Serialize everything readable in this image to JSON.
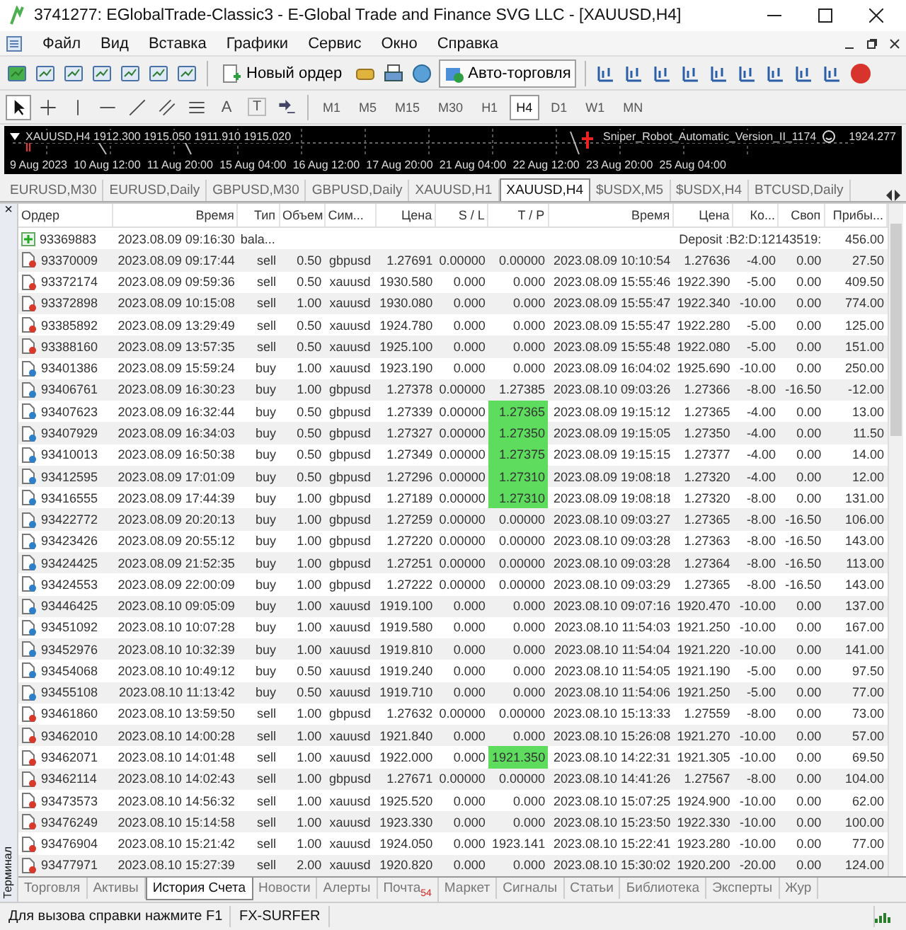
{
  "window": {
    "title": "3741277: EGlobalTrade-Classic3 - E-Global Trade and Finance SVG LLC - [XAUUSD,H4]"
  },
  "menu": [
    "Файл",
    "Вид",
    "Вставка",
    "Графики",
    "Сервис",
    "Окно",
    "Справка"
  ],
  "toolbar": {
    "new_order": "Новый ордер",
    "auto_trading": {
      "label": "Авто-торговля",
      "on": true
    }
  },
  "draw_tools": [
    {
      "kind": "cursor",
      "selected": true
    },
    {
      "kind": "crosshair",
      "selected": false
    },
    {
      "kind": "vline",
      "selected": false
    },
    {
      "kind": "hline",
      "selected": false
    },
    {
      "kind": "trend",
      "selected": false
    },
    {
      "kind": "channel",
      "selected": false
    },
    {
      "kind": "fibo",
      "selected": false
    },
    {
      "kind": "text",
      "label": "A",
      "selected": false
    },
    {
      "kind": "label",
      "label": "T",
      "selected": false
    },
    {
      "kind": "arrows",
      "selected": false
    }
  ],
  "timeframes": [
    {
      "label": "M1",
      "selected": false
    },
    {
      "label": "M5",
      "selected": false
    },
    {
      "label": "M15",
      "selected": false
    },
    {
      "label": "M30",
      "selected": false
    },
    {
      "label": "H1",
      "selected": false
    },
    {
      "label": "H4",
      "selected": true
    },
    {
      "label": "D1",
      "selected": false
    },
    {
      "label": "W1",
      "selected": false
    },
    {
      "label": "MN",
      "selected": false
    }
  ],
  "chart": {
    "symbol_line": "XAUUSD,H4  1912.300 1915.050 1911.910 1915.020",
    "expert": "Sniper_Robot_Automatic_Version_II_1174",
    "price": "1924.277",
    "dates": [
      "9 Aug 2023",
      "10 Aug 12:00",
      "11 Aug 20:00",
      "15 Aug 04:00",
      "16 Aug 12:00",
      "17 Aug 20:00",
      "21 Aug 04:00",
      "22 Aug 12:00",
      "23 Aug 20:00",
      "25 Aug 04:00"
    ]
  },
  "chart_tabs": [
    {
      "label": "EURUSD,M30",
      "selected": false
    },
    {
      "label": "EURUSD,Daily",
      "selected": false
    },
    {
      "label": "GBPUSD,M30",
      "selected": false
    },
    {
      "label": "GBPUSD,Daily",
      "selected": false
    },
    {
      "label": "XAUUSD,H1",
      "selected": false
    },
    {
      "label": "XAUUSD,H4",
      "selected": true
    },
    {
      "label": "$USDX,M5",
      "selected": false
    },
    {
      "label": "$USDX,H4",
      "selected": false
    },
    {
      "label": "BTCUSD,Daily",
      "selected": false
    }
  ],
  "terminal": {
    "label": "Терминал",
    "close": "×"
  },
  "table": {
    "columns": [
      "Ордер",
      "Время",
      "Тип",
      "Объем",
      "Сим...",
      "Цена",
      "S / L",
      "T / P",
      "Время",
      "Цена",
      "Ко...",
      "Своп",
      "Прибы..."
    ],
    "rows": [
      {
        "kind": "balance",
        "order": "93369883",
        "open_time": "2023.08.09 09:16:30",
        "type": "bala...",
        "comment": "Deposit :B2:D:12143519:",
        "profit": "456.00"
      },
      {
        "kind": "sell",
        "order": "93370009",
        "open_time": "2023.08.09 09:17:44",
        "type": "sell",
        "volume": "0.50",
        "symbol": "gbpusd",
        "price": "1.27691",
        "sl": "0.00000",
        "tp": "0.00000",
        "tp_hit": false,
        "close_time": "2023.08.09 10:10:54",
        "close_price": "1.27636",
        "commission": "-4.00",
        "swap": "0.00",
        "profit": "27.50"
      },
      {
        "kind": "sell",
        "order": "93372174",
        "open_time": "2023.08.09 09:59:36",
        "type": "sell",
        "volume": "0.50",
        "symbol": "xauusd",
        "price": "1930.580",
        "sl": "0.000",
        "tp": "0.000",
        "tp_hit": false,
        "close_time": "2023.08.09 15:55:46",
        "close_price": "1922.390",
        "commission": "-5.00",
        "swap": "0.00",
        "profit": "409.50"
      },
      {
        "kind": "sell",
        "order": "93372898",
        "open_time": "2023.08.09 10:15:08",
        "type": "sell",
        "volume": "1.00",
        "symbol": "xauusd",
        "price": "1930.080",
        "sl": "0.000",
        "tp": "0.000",
        "tp_hit": false,
        "close_time": "2023.08.09 15:55:47",
        "close_price": "1922.340",
        "commission": "-10.00",
        "swap": "0.00",
        "profit": "774.00"
      },
      {
        "kind": "sell",
        "order": "93385892",
        "open_time": "2023.08.09 13:29:49",
        "type": "sell",
        "volume": "0.50",
        "symbol": "xauusd",
        "price": "1924.780",
        "sl": "0.000",
        "tp": "0.000",
        "tp_hit": false,
        "close_time": "2023.08.09 15:55:47",
        "close_price": "1922.280",
        "commission": "-5.00",
        "swap": "0.00",
        "profit": "125.00"
      },
      {
        "kind": "sell",
        "order": "93388160",
        "open_time": "2023.08.09 13:57:35",
        "type": "sell",
        "volume": "0.50",
        "symbol": "xauusd",
        "price": "1925.100",
        "sl": "0.000",
        "tp": "0.000",
        "tp_hit": false,
        "close_time": "2023.08.09 15:55:48",
        "close_price": "1922.080",
        "commission": "-5.00",
        "swap": "0.00",
        "profit": "151.00"
      },
      {
        "kind": "buy",
        "order": "93401386",
        "open_time": "2023.08.09 15:59:24",
        "type": "buy",
        "volume": "1.00",
        "symbol": "xauusd",
        "price": "1923.190",
        "sl": "0.000",
        "tp": "0.000",
        "tp_hit": false,
        "close_time": "2023.08.09 16:04:02",
        "close_price": "1925.690",
        "commission": "-10.00",
        "swap": "0.00",
        "profit": "250.00"
      },
      {
        "kind": "buy",
        "order": "93406761",
        "open_time": "2023.08.09 16:30:23",
        "type": "buy",
        "volume": "1.00",
        "symbol": "gbpusd",
        "price": "1.27378",
        "sl": "0.00000",
        "tp": "1.27385",
        "tp_hit": false,
        "close_time": "2023.08.10 09:03:26",
        "close_price": "1.27366",
        "commission": "-8.00",
        "swap": "-16.50",
        "profit": "-12.00"
      },
      {
        "kind": "buy",
        "order": "93407623",
        "open_time": "2023.08.09 16:32:44",
        "type": "buy",
        "volume": "0.50",
        "symbol": "gbpusd",
        "price": "1.27339",
        "sl": "0.00000",
        "tp": "1.27365",
        "tp_hit": true,
        "close_time": "2023.08.09 19:15:12",
        "close_price": "1.27365",
        "commission": "-4.00",
        "swap": "0.00",
        "profit": "13.00"
      },
      {
        "kind": "buy",
        "order": "93407929",
        "open_time": "2023.08.09 16:34:03",
        "type": "buy",
        "volume": "0.50",
        "symbol": "gbpusd",
        "price": "1.27327",
        "sl": "0.00000",
        "tp": "1.27350",
        "tp_hit": true,
        "close_time": "2023.08.09 19:15:05",
        "close_price": "1.27350",
        "commission": "-4.00",
        "swap": "0.00",
        "profit": "11.50"
      },
      {
        "kind": "buy",
        "order": "93410013",
        "open_time": "2023.08.09 16:50:38",
        "type": "buy",
        "volume": "0.50",
        "symbol": "gbpusd",
        "price": "1.27349",
        "sl": "0.00000",
        "tp": "1.27375",
        "tp_hit": true,
        "close_time": "2023.08.09 19:15:15",
        "close_price": "1.27377",
        "commission": "-4.00",
        "swap": "0.00",
        "profit": "14.00"
      },
      {
        "kind": "buy",
        "order": "93412595",
        "open_time": "2023.08.09 17:01:09",
        "type": "buy",
        "volume": "0.50",
        "symbol": "gbpusd",
        "price": "1.27296",
        "sl": "0.00000",
        "tp": "1.27310",
        "tp_hit": true,
        "close_time": "2023.08.09 19:08:18",
        "close_price": "1.27320",
        "commission": "-4.00",
        "swap": "0.00",
        "profit": "12.00"
      },
      {
        "kind": "buy",
        "order": "93416555",
        "open_time": "2023.08.09 17:44:39",
        "type": "buy",
        "volume": "1.00",
        "symbol": "gbpusd",
        "price": "1.27189",
        "sl": "0.00000",
        "tp": "1.27310",
        "tp_hit": true,
        "close_time": "2023.08.09 19:08:18",
        "close_price": "1.27320",
        "commission": "-8.00",
        "swap": "0.00",
        "profit": "131.00"
      },
      {
        "kind": "buy",
        "order": "93422772",
        "open_time": "2023.08.09 20:20:13",
        "type": "buy",
        "volume": "1.00",
        "symbol": "gbpusd",
        "price": "1.27259",
        "sl": "0.00000",
        "tp": "0.00000",
        "tp_hit": false,
        "close_time": "2023.08.10 09:03:27",
        "close_price": "1.27365",
        "commission": "-8.00",
        "swap": "-16.50",
        "profit": "106.00"
      },
      {
        "kind": "buy",
        "order": "93423426",
        "open_time": "2023.08.09 20:55:12",
        "type": "buy",
        "volume": "1.00",
        "symbol": "gbpusd",
        "price": "1.27220",
        "sl": "0.00000",
        "tp": "0.00000",
        "tp_hit": false,
        "close_time": "2023.08.10 09:03:28",
        "close_price": "1.27363",
        "commission": "-8.00",
        "swap": "-16.50",
        "profit": "143.00"
      },
      {
        "kind": "buy",
        "order": "93424425",
        "open_time": "2023.08.09 21:52:35",
        "type": "buy",
        "volume": "1.00",
        "symbol": "gbpusd",
        "price": "1.27251",
        "sl": "0.00000",
        "tp": "0.00000",
        "tp_hit": false,
        "close_time": "2023.08.10 09:03:28",
        "close_price": "1.27364",
        "commission": "-8.00",
        "swap": "-16.50",
        "profit": "113.00"
      },
      {
        "kind": "buy",
        "order": "93424553",
        "open_time": "2023.08.09 22:00:09",
        "type": "buy",
        "volume": "1.00",
        "symbol": "gbpusd",
        "price": "1.27222",
        "sl": "0.00000",
        "tp": "0.00000",
        "tp_hit": false,
        "close_time": "2023.08.10 09:03:29",
        "close_price": "1.27365",
        "commission": "-8.00",
        "swap": "-16.50",
        "profit": "143.00"
      },
      {
        "kind": "buy",
        "order": "93446425",
        "open_time": "2023.08.10 09:05:09",
        "type": "buy",
        "volume": "1.00",
        "symbol": "xauusd",
        "price": "1919.100",
        "sl": "0.000",
        "tp": "0.000",
        "tp_hit": false,
        "close_time": "2023.08.10 09:07:16",
        "close_price": "1920.470",
        "commission": "-10.00",
        "swap": "0.00",
        "profit": "137.00"
      },
      {
        "kind": "buy",
        "order": "93451092",
        "open_time": "2023.08.10 10:07:28",
        "type": "buy",
        "volume": "1.00",
        "symbol": "xauusd",
        "price": "1919.580",
        "sl": "0.000",
        "tp": "0.000",
        "tp_hit": false,
        "close_time": "2023.08.10 11:54:03",
        "close_price": "1921.250",
        "commission": "-10.00",
        "swap": "0.00",
        "profit": "167.00"
      },
      {
        "kind": "buy",
        "order": "93452976",
        "open_time": "2023.08.10 10:32:39",
        "type": "buy",
        "volume": "1.00",
        "symbol": "xauusd",
        "price": "1919.810",
        "sl": "0.000",
        "tp": "0.000",
        "tp_hit": false,
        "close_time": "2023.08.10 11:54:04",
        "close_price": "1921.220",
        "commission": "-10.00",
        "swap": "0.00",
        "profit": "141.00"
      },
      {
        "kind": "buy",
        "order": "93454068",
        "open_time": "2023.08.10 10:49:12",
        "type": "buy",
        "volume": "0.50",
        "symbol": "xauusd",
        "price": "1919.240",
        "sl": "0.000",
        "tp": "0.000",
        "tp_hit": false,
        "close_time": "2023.08.10 11:54:05",
        "close_price": "1921.190",
        "commission": "-5.00",
        "swap": "0.00",
        "profit": "97.50"
      },
      {
        "kind": "buy",
        "order": "93455108",
        "open_time": "2023.08.10 11:13:42",
        "type": "buy",
        "volume": "0.50",
        "symbol": "xauusd",
        "price": "1919.710",
        "sl": "0.000",
        "tp": "0.000",
        "tp_hit": false,
        "close_time": "2023.08.10 11:54:06",
        "close_price": "1921.250",
        "commission": "-5.00",
        "swap": "0.00",
        "profit": "77.00"
      },
      {
        "kind": "sell",
        "order": "93461860",
        "open_time": "2023.08.10 13:59:50",
        "type": "sell",
        "volume": "1.00",
        "symbol": "gbpusd",
        "price": "1.27632",
        "sl": "0.00000",
        "tp": "0.00000",
        "tp_hit": false,
        "close_time": "2023.08.10 15:13:33",
        "close_price": "1.27559",
        "commission": "-8.00",
        "swap": "0.00",
        "profit": "73.00"
      },
      {
        "kind": "sell",
        "order": "93462010",
        "open_time": "2023.08.10 14:00:28",
        "type": "sell",
        "volume": "1.00",
        "symbol": "xauusd",
        "price": "1921.840",
        "sl": "0.000",
        "tp": "0.000",
        "tp_hit": false,
        "close_time": "2023.08.10 15:26:08",
        "close_price": "1921.270",
        "commission": "-10.00",
        "swap": "0.00",
        "profit": "57.00"
      },
      {
        "kind": "sell",
        "order": "93462071",
        "open_time": "2023.08.10 14:01:48",
        "type": "sell",
        "volume": "1.00",
        "symbol": "xauusd",
        "price": "1922.000",
        "sl": "0.000",
        "tp": "1921.350",
        "tp_hit": true,
        "close_time": "2023.08.10 14:22:31",
        "close_price": "1921.305",
        "commission": "-10.00",
        "swap": "0.00",
        "profit": "69.50"
      },
      {
        "kind": "sell",
        "order": "93462114",
        "open_time": "2023.08.10 14:02:43",
        "type": "sell",
        "volume": "1.00",
        "symbol": "gbpusd",
        "price": "1.27671",
        "sl": "0.00000",
        "tp": "0.00000",
        "tp_hit": false,
        "close_time": "2023.08.10 14:41:26",
        "close_price": "1.27567",
        "commission": "-8.00",
        "swap": "0.00",
        "profit": "104.00"
      },
      {
        "kind": "sell",
        "order": "93473573",
        "open_time": "2023.08.10 14:56:32",
        "type": "sell",
        "volume": "1.00",
        "symbol": "xauusd",
        "price": "1925.520",
        "sl": "0.000",
        "tp": "0.000",
        "tp_hit": false,
        "close_time": "2023.08.10 15:07:25",
        "close_price": "1924.900",
        "commission": "-10.00",
        "swap": "0.00",
        "profit": "62.00"
      },
      {
        "kind": "sell",
        "order": "93476249",
        "open_time": "2023.08.10 15:14:58",
        "type": "sell",
        "volume": "1.00",
        "symbol": "xauusd",
        "price": "1923.330",
        "sl": "0.000",
        "tp": "0.000",
        "tp_hit": false,
        "close_time": "2023.08.10 15:23:50",
        "close_price": "1922.330",
        "commission": "-10.00",
        "swap": "0.00",
        "profit": "100.00"
      },
      {
        "kind": "sell",
        "order": "93476904",
        "open_time": "2023.08.10 15:21:42",
        "type": "sell",
        "volume": "1.00",
        "symbol": "xauusd",
        "price": "1924.050",
        "sl": "0.000",
        "tp": "1923.141",
        "tp_hit": false,
        "close_time": "2023.08.10 15:22:41",
        "close_price": "1923.280",
        "commission": "-10.00",
        "swap": "0.00",
        "profit": "77.00"
      },
      {
        "kind": "sell",
        "order": "93477971",
        "open_time": "2023.08.10 15:27:39",
        "type": "sell",
        "volume": "2.00",
        "symbol": "xauusd",
        "price": "1920.820",
        "sl": "0.000",
        "tp": "0.000",
        "tp_hit": false,
        "close_time": "2023.08.10 15:30:02",
        "close_price": "1920.200",
        "commission": "-20.00",
        "swap": "0.00",
        "profit": "124.00"
      }
    ]
  },
  "bottom_tabs": [
    {
      "label": "Торговля",
      "selected": false
    },
    {
      "label": "Активы",
      "selected": false
    },
    {
      "label": "История Счета",
      "selected": true
    },
    {
      "label": "Новости",
      "selected": false
    },
    {
      "label": "Алерты",
      "selected": false
    },
    {
      "label": "Почта",
      "badge": "54",
      "selected": false
    },
    {
      "label": "Маркет",
      "selected": false
    },
    {
      "label": "Сигналы",
      "selected": false
    },
    {
      "label": "Статьи",
      "selected": false
    },
    {
      "label": "Библиотека",
      "selected": false
    },
    {
      "label": "Эксперты",
      "selected": false
    },
    {
      "label": "Жур",
      "selected": false
    }
  ],
  "status_bar": [
    "Для вызова справки нажмите F1",
    "FX-SURFER"
  ]
}
